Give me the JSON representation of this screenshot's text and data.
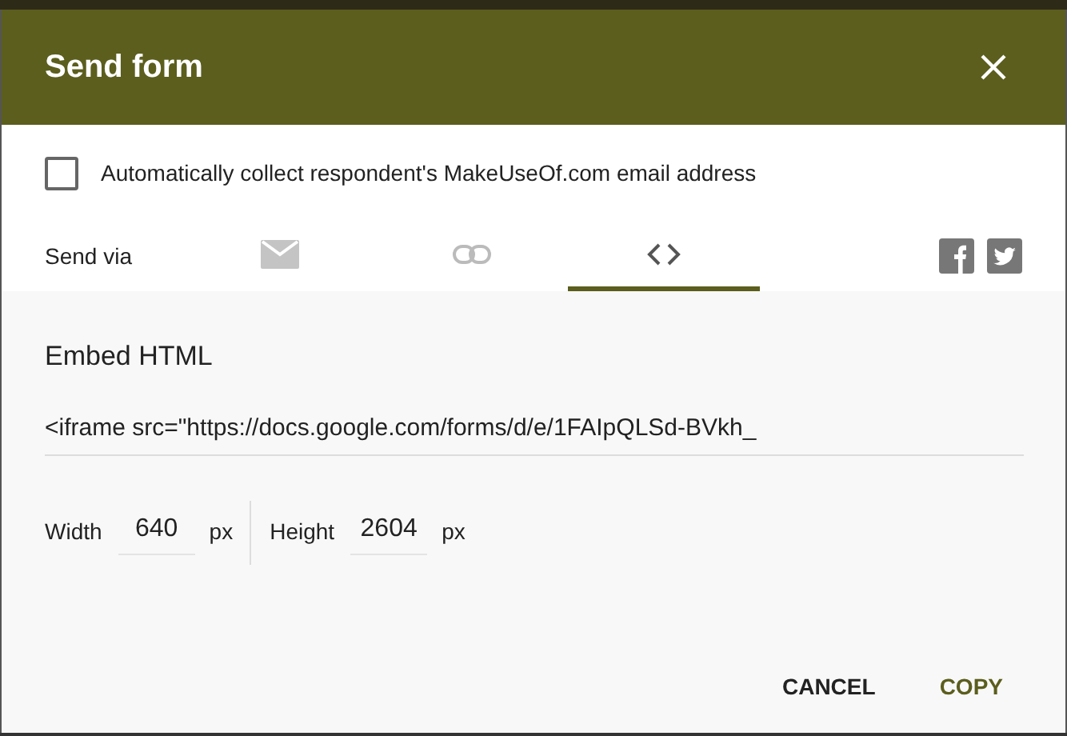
{
  "dialog": {
    "title": "Send form"
  },
  "collect_email": {
    "label": "Automatically collect respondent's MakeUseOf.com email address",
    "checked": false
  },
  "send_via": {
    "label": "Send via",
    "tabs": [
      {
        "kind": "email",
        "selected": false
      },
      {
        "kind": "link",
        "selected": false
      },
      {
        "kind": "embed",
        "selected": true
      }
    ],
    "share": [
      {
        "kind": "facebook"
      },
      {
        "kind": "twitter"
      }
    ]
  },
  "embed": {
    "heading": "Embed HTML",
    "code": "<iframe src=\"https://docs.google.com/forms/d/e/1FAIpQLSd-BVkh_",
    "width": {
      "label": "Width",
      "value": "640",
      "unit": "px"
    },
    "height": {
      "label": "Height",
      "value": "2604",
      "unit": "px"
    }
  },
  "buttons": [
    {
      "kind": "cancel",
      "label": "CANCEL"
    },
    {
      "kind": "copy",
      "label": "COPY"
    }
  ]
}
